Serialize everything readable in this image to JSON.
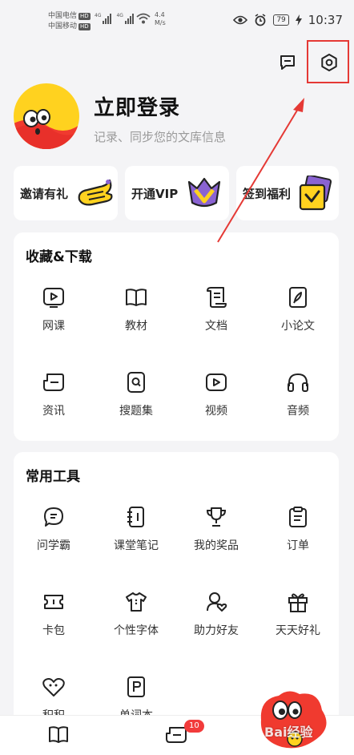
{
  "status_bar": {
    "carrier1": "中国电信",
    "carrier2": "中国移动",
    "hd": "HD",
    "signal_gen": "4G",
    "net_speed_value": "4.4",
    "net_speed_unit": "M/s",
    "battery": "79",
    "time": "10:37"
  },
  "header": {
    "icons": [
      "message-icon",
      "settings-icon"
    ]
  },
  "profile": {
    "title": "立即登录",
    "subtitle": "记录、同步您的文库信息"
  },
  "quick_cards": [
    {
      "label": "邀请有礼",
      "icon": "invite-gift-icon"
    },
    {
      "label": "开通VIP",
      "icon": "vip-crown-icon"
    },
    {
      "label": "签到福利",
      "icon": "checkin-card-icon"
    }
  ],
  "favorites": {
    "title": "收藏&下载",
    "items": [
      {
        "label": "网课",
        "icon": "play-screen-icon"
      },
      {
        "label": "教材",
        "icon": "book-icon"
      },
      {
        "label": "文档",
        "icon": "scroll-doc-icon"
      },
      {
        "label": "小论文",
        "icon": "pen-nib-icon"
      },
      {
        "label": "资讯",
        "icon": "news-icon"
      },
      {
        "label": "搜题集",
        "icon": "search-doc-icon"
      },
      {
        "label": "视频",
        "icon": "video-play-icon"
      },
      {
        "label": "音频",
        "icon": "headphones-icon"
      }
    ]
  },
  "tools": {
    "title": "常用工具",
    "items": [
      {
        "label": "问学霸",
        "icon": "chat-bubble-icon"
      },
      {
        "label": "课堂笔记",
        "icon": "notebook-icon"
      },
      {
        "label": "我的奖品",
        "icon": "trophy-icon"
      },
      {
        "label": "订单",
        "icon": "clipboard-icon"
      },
      {
        "label": "卡包",
        "icon": "ticket-icon"
      },
      {
        "label": "个性字体",
        "icon": "tshirt-icon"
      },
      {
        "label": "助力好友",
        "icon": "friend-heart-icon"
      },
      {
        "label": "天天好礼",
        "icon": "gift-box-icon"
      },
      {
        "label": "积积",
        "icon": "heart-face-icon"
      },
      {
        "label": "单词本",
        "icon": "p-book-icon"
      }
    ]
  },
  "bottom_nav": {
    "items": [
      "library-book-icon",
      "learn-tab-icon"
    ],
    "badge": "10"
  },
  "watermark": "Bai经验"
}
